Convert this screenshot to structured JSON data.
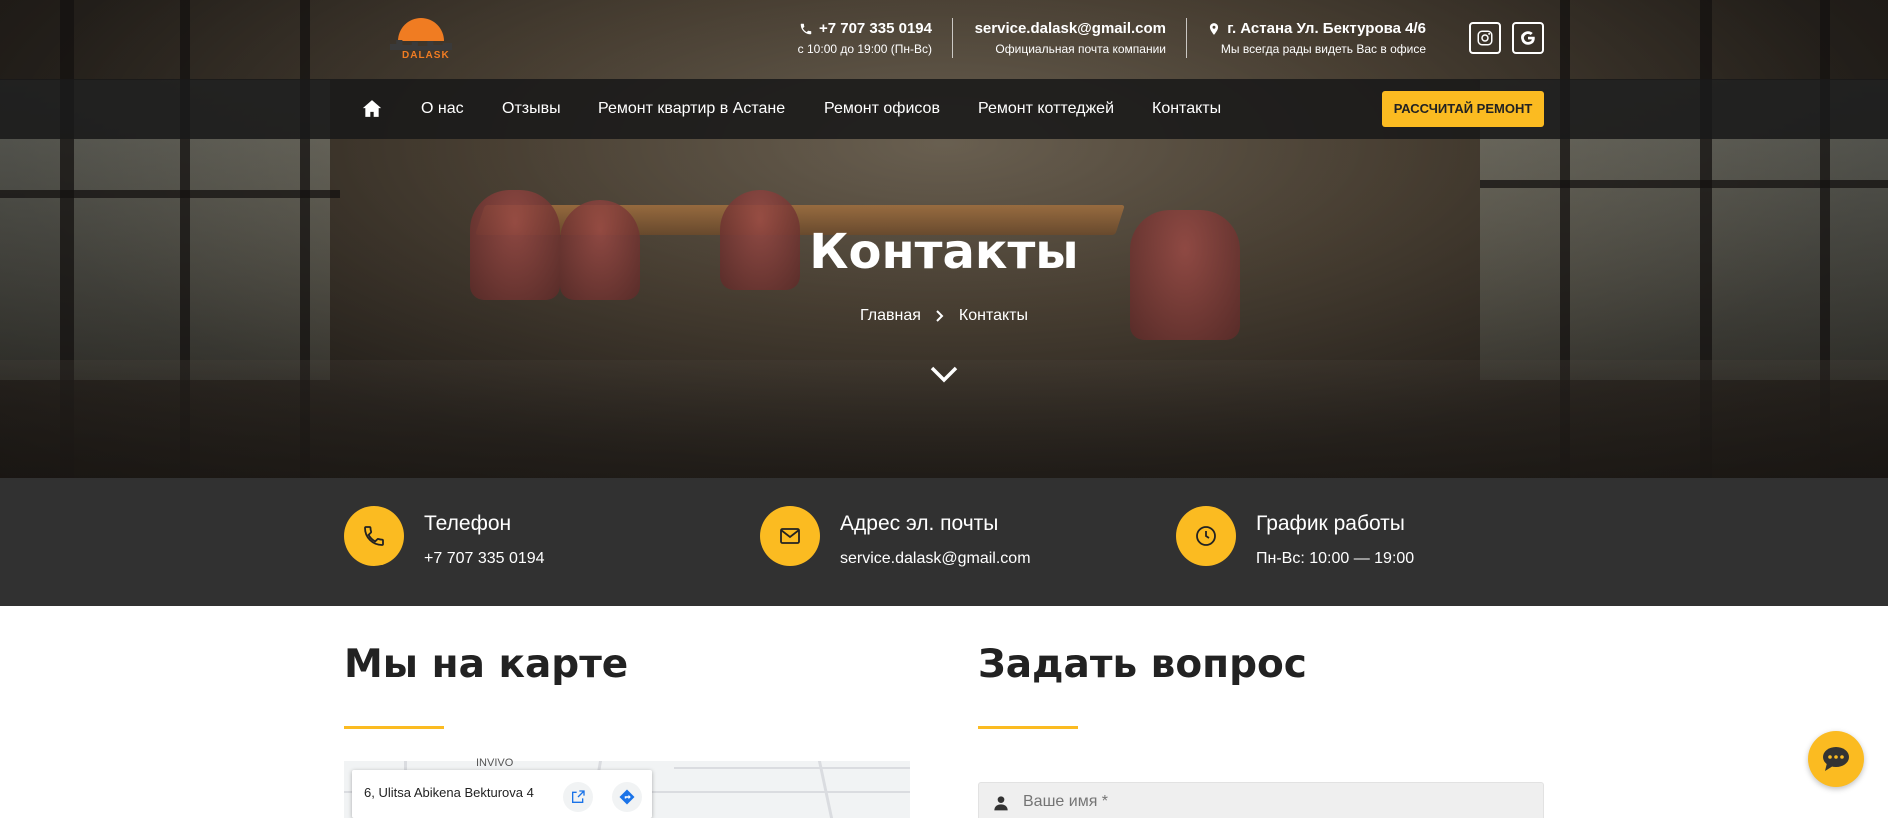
{
  "topbar": {
    "phone": "+7 707 335 0194",
    "hours": "с 10:00 до 19:00 (Пн-Вс)",
    "email": "service.dalask@gmail.com",
    "email_sub": "Официальная почта компании",
    "address": "г. Астана Ул. Бектурова 4/6",
    "address_sub": "Мы всегда рады видеть Вас в офисе",
    "social": [
      "instagram-icon",
      "google-icon"
    ]
  },
  "logo": {
    "text": "DALASK"
  },
  "nav": {
    "items": [
      "О нас",
      "Отзывы",
      "Ремонт квартир в Астане",
      "Ремонт офисов",
      "Ремонт коттеджей",
      "Контакты"
    ],
    "cta": "РАССЧИТАЙ РЕМОНТ"
  },
  "hero": {
    "title": "Контакты",
    "breadcrumb": [
      "Главная",
      "Контакты"
    ]
  },
  "info": [
    {
      "icon": "phone-icon",
      "title": "Телефон",
      "value": "+7 707 335 0194"
    },
    {
      "icon": "mail-icon",
      "title": "Адрес эл. почты",
      "value": "service.dalask@gmail.com"
    },
    {
      "icon": "clock-icon",
      "title": "График работы",
      "value": "Пн-Вс: 10:00 — 19:00"
    }
  ],
  "map_section": {
    "title": "Мы на карте",
    "card_address": "6, Ulitsa Abikena Bekturova 4",
    "map_label": "INVIVO"
  },
  "form_section": {
    "title": "Задать вопрос",
    "name_placeholder": "Ваше имя *"
  },
  "colors": {
    "accent": "#fbbb21",
    "dark_bar": "#313131",
    "nav_bg": "#191919"
  }
}
